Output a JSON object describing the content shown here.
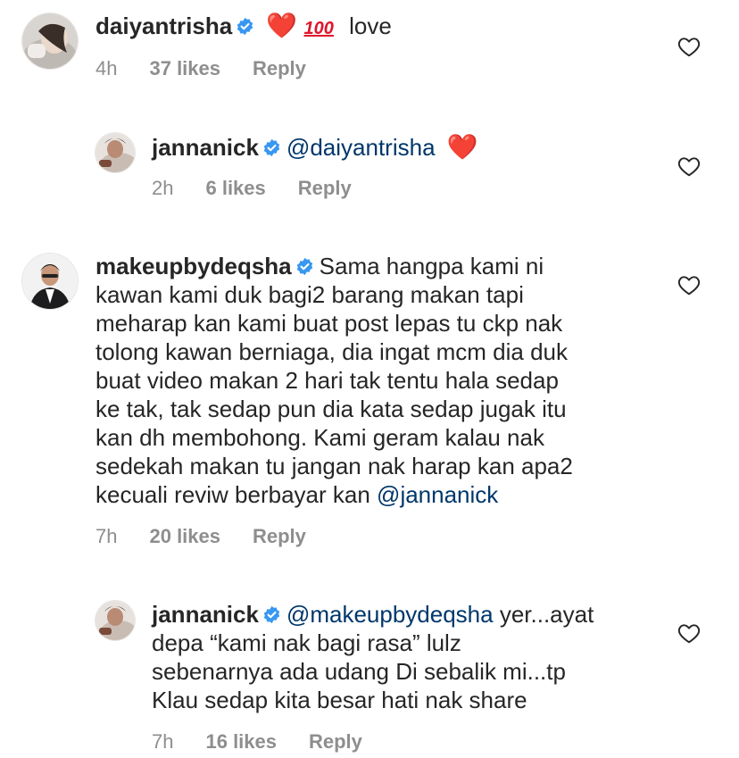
{
  "comments": [
    {
      "username": "daiyantrisha",
      "verified": true,
      "emoji_heart": "❤️",
      "emoji_hundred": "100",
      "text": "love",
      "time": "4h",
      "likes": "37 likes",
      "reply": "Reply"
    },
    {
      "username": "jannanick",
      "verified": true,
      "mention": "@daiyantrisha",
      "emoji_heart": "❤️",
      "time": "2h",
      "likes": "6 likes",
      "reply": "Reply"
    },
    {
      "username": "makeupbydeqsha",
      "verified": true,
      "text_lines": [
        "Sama hangpa kami ni",
        "kawan kami duk bagi2 barang makan tapi",
        "meharap kan kami buat post lepas tu ckp nak",
        "tolong kawan berniaga, dia ingat mcm dia duk",
        "buat video makan 2 hari tak tentu hala sedap",
        "ke tak, tak sedap pun dia kata sedap jugak itu",
        "kan dh membohong. Kami geram kalau nak",
        "sedekah makan tu jangan nak harap kan apa2",
        "kecuali reviw berbayar kan"
      ],
      "mention": "@jannanick",
      "time": "7h",
      "likes": "20 likes",
      "reply": "Reply"
    },
    {
      "username": "jannanick",
      "verified": true,
      "mention": "@makeupbydeqsha",
      "text_lines": [
        "yer...ayat",
        "depa “kami nak bagi rasa” lulz",
        "sebenarnya ada udang Di sebalik mi...tp",
        "Klau sedap kita besar hati nak share"
      ],
      "time": "7h",
      "likes": "16 likes",
      "reply": "Reply"
    }
  ],
  "colors": {
    "text": "#262626",
    "meta": "#8e8e8e",
    "mention": "#00376b",
    "verified": "#3897f0",
    "heart": "#e0142b"
  },
  "icons": {
    "verified": "verified-badge-icon",
    "like": "heart-outline-icon"
  }
}
